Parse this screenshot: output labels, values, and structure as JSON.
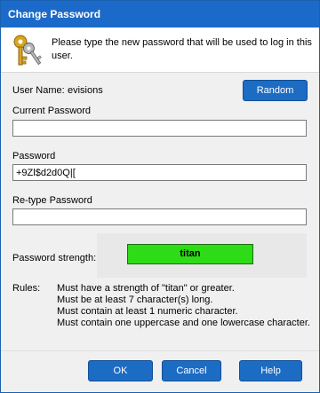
{
  "window": {
    "title": "Change Password"
  },
  "header": {
    "text": "Please type the new password that will be used to log in this user."
  },
  "user": {
    "label": "User Name:",
    "value": "evisions"
  },
  "random_button": "Random",
  "current_password": {
    "label": "Current Password",
    "value": ""
  },
  "password": {
    "label": "Password",
    "value": "+9Zl$d2d0Q|["
  },
  "retype_password": {
    "label": "Re-type Password",
    "value": ""
  },
  "strength": {
    "label": "Password strength:",
    "value": "titan",
    "color": "#2ddb17"
  },
  "rules": {
    "label": "Rules:",
    "items": [
      "Must have a strength of \"titan\" or greater.",
      "Must be at least 7 character(s) long.",
      "Must contain at least 1 numeric character.",
      "Must contain one uppercase and one lowercase character."
    ]
  },
  "buttons": {
    "ok": "OK",
    "cancel": "Cancel",
    "help": "Help"
  },
  "colors": {
    "accent": "#1b6ac9",
    "button": "#1c6cc4"
  },
  "icons": {
    "header": "keys-icon"
  }
}
